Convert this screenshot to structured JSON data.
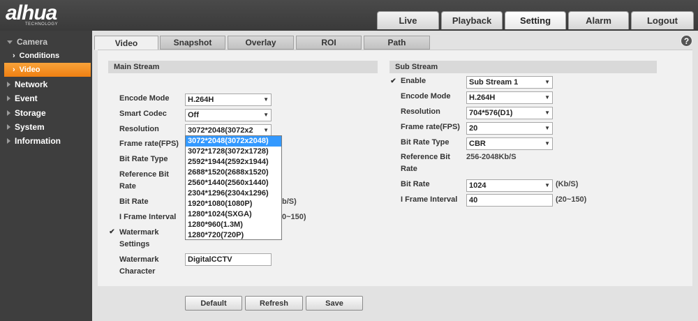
{
  "brand": {
    "name": "alhua",
    "tagline": "TECHNOLOGY"
  },
  "top_nav": [
    "Live",
    "Playback",
    "Setting",
    "Alarm",
    "Logout"
  ],
  "sidebar": {
    "camera": "Camera",
    "conditions": "Conditions",
    "video": "Video",
    "network": "Network",
    "event": "Event",
    "storage": "Storage",
    "system": "System",
    "information": "Information"
  },
  "sub_tabs": [
    "Video",
    "Snapshot",
    "Overlay",
    "ROI",
    "Path"
  ],
  "help": "?",
  "main_stream": {
    "title": "Main Stream",
    "encode_mode": {
      "label": "Encode Mode",
      "value": "H.264H"
    },
    "smart_codec": {
      "label": "Smart Codec",
      "value": "Off"
    },
    "resolution": {
      "label": "Resolution",
      "value": "3072*2048(3072x2"
    },
    "frame_rate": {
      "label": "Frame rate(FPS)"
    },
    "bit_rate_type": {
      "label": "Bit Rate Type"
    },
    "reference_bit_rate": {
      "label1": "Reference Bit",
      "label2": "Rate"
    },
    "bit_rate": {
      "label": "Bit Rate",
      "unit_fragment": "b/S)"
    },
    "i_frame": {
      "label": "I Frame Interval",
      "range_fragment": "0~150)"
    },
    "watermark_settings": {
      "label1": "Watermark",
      "label2": "Settings",
      "checked": true
    },
    "watermark_char": {
      "label1": "Watermark",
      "label2": "Character",
      "value": "DigitalCCTV"
    },
    "resolution_options": [
      "3072*2048(3072x2048)",
      "3072*1728(3072x1728)",
      "2592*1944(2592x1944)",
      "2688*1520(2688x1520)",
      "2560*1440(2560x1440)",
      "2304*1296(2304x1296)",
      "1920*1080(1080P)",
      "1280*1024(SXGA)",
      "1280*960(1.3M)",
      "1280*720(720P)"
    ]
  },
  "sub_stream": {
    "title": "Sub Stream",
    "enable": {
      "label": "Enable",
      "value": "Sub Stream 1",
      "checked": true
    },
    "encode_mode": {
      "label": "Encode Mode",
      "value": "H.264H"
    },
    "resolution": {
      "label": "Resolution",
      "value": "704*576(D1)"
    },
    "frame_rate": {
      "label": "Frame rate(FPS)",
      "value": "20"
    },
    "bit_rate_type": {
      "label": "Bit Rate Type",
      "value": "CBR"
    },
    "reference_bit_rate": {
      "label1": "Reference Bit",
      "label2": "Rate",
      "value": "256-2048Kb/S"
    },
    "bit_rate": {
      "label": "Bit Rate",
      "value": "1024",
      "unit": "(Kb/S)"
    },
    "i_frame": {
      "label": "I Frame Interval",
      "value": "40",
      "range": "(20~150)"
    }
  },
  "buttons": {
    "default": "Default",
    "refresh": "Refresh",
    "save": "Save"
  }
}
